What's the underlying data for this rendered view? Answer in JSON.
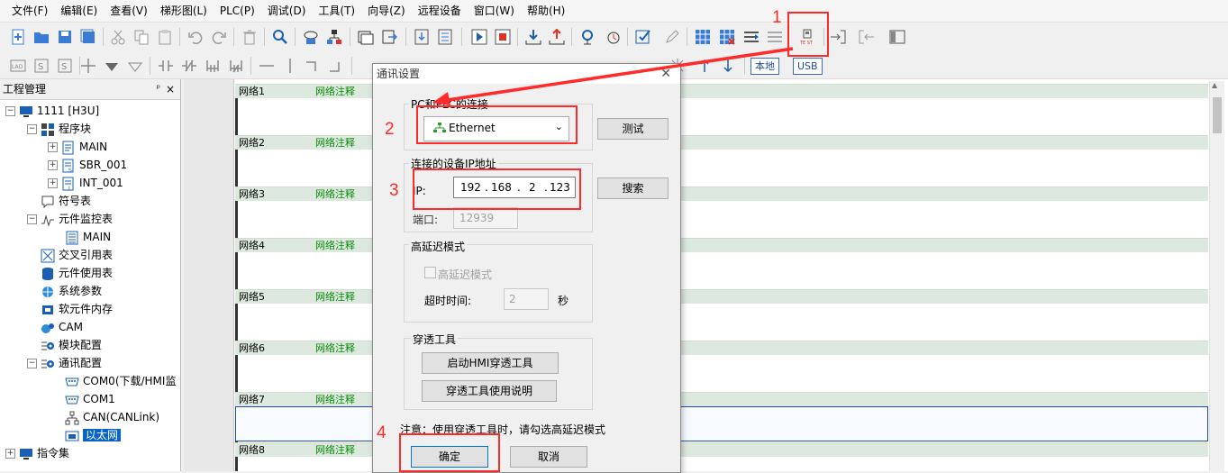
{
  "menu": [
    "文件(F)",
    "编辑(E)",
    "查看(V)",
    "梯形图(L)",
    "PLC(P)",
    "调试(D)",
    "工具(T)",
    "向导(Z)",
    "远程设备",
    "窗口(W)",
    "帮助(H)"
  ],
  "toolbar2": {
    "local_label": "本地",
    "usb_label": "USB"
  },
  "project": {
    "title": "工程管理",
    "pin": "ᵖ",
    "close": "×",
    "items": [
      {
        "label": "1111 [H3U]"
      },
      {
        "label": "程序块"
      },
      {
        "label": "MAIN"
      },
      {
        "label": "SBR_001"
      },
      {
        "label": "INT_001"
      },
      {
        "label": "符号表"
      },
      {
        "label": "元件监控表"
      },
      {
        "label": "MAIN"
      },
      {
        "label": "交叉引用表"
      },
      {
        "label": "元件使用表"
      },
      {
        "label": "系统参数"
      },
      {
        "label": "软元件内存"
      },
      {
        "label": "CAM"
      },
      {
        "label": "模块配置"
      },
      {
        "label": "通讯配置"
      },
      {
        "label": "COM0(下载/HMI监"
      },
      {
        "label": "COM1"
      },
      {
        "label": "CAN(CANLink)"
      },
      {
        "label": "以太网"
      },
      {
        "label": "指令集"
      }
    ]
  },
  "networks": [
    {
      "name": "网络1",
      "comment": "网络注释"
    },
    {
      "name": "网络2",
      "comment": "网络注释"
    },
    {
      "name": "网络3",
      "comment": "网络注释"
    },
    {
      "name": "网络4",
      "comment": "网络注释"
    },
    {
      "name": "网络5",
      "comment": "网络注释"
    },
    {
      "name": "网络6",
      "comment": "网络注释"
    },
    {
      "name": "网络7",
      "comment": "网络注释"
    },
    {
      "name": "网络8",
      "comment": "网络注释"
    }
  ],
  "dialog": {
    "title": "通讯设置",
    "close": "✕",
    "pc_connection_label": "PC和PLC的连接",
    "connection_type": "Ethernet",
    "test_button": "测试",
    "ip_group_label": "连接的设备IP地址",
    "ip_label": "IP:",
    "ip": [
      "192",
      "168",
      "2",
      "123"
    ],
    "search_button": "搜索",
    "port_label": "端口:",
    "port": "12939",
    "high_delay_group": "高延迟模式",
    "high_delay_checkbox": "高延迟模式",
    "timeout_label": "超时时间:",
    "timeout_value": "2",
    "timeout_unit": "秒",
    "passthrough_group": "穿透工具",
    "start_hmi_button": "启动HMI穿透工具",
    "passthrough_help_button": "穿透工具使用说明",
    "note": "注意：使用穿透工具时，请勾选高延迟模式",
    "ok_button": "确定",
    "cancel_button": "取消"
  },
  "annotations": [
    "1",
    "2",
    "3",
    "4"
  ],
  "colors": {
    "annotation": "#ff2a2a",
    "comment": "#0a8a0a",
    "selection": "#0a64c8"
  }
}
